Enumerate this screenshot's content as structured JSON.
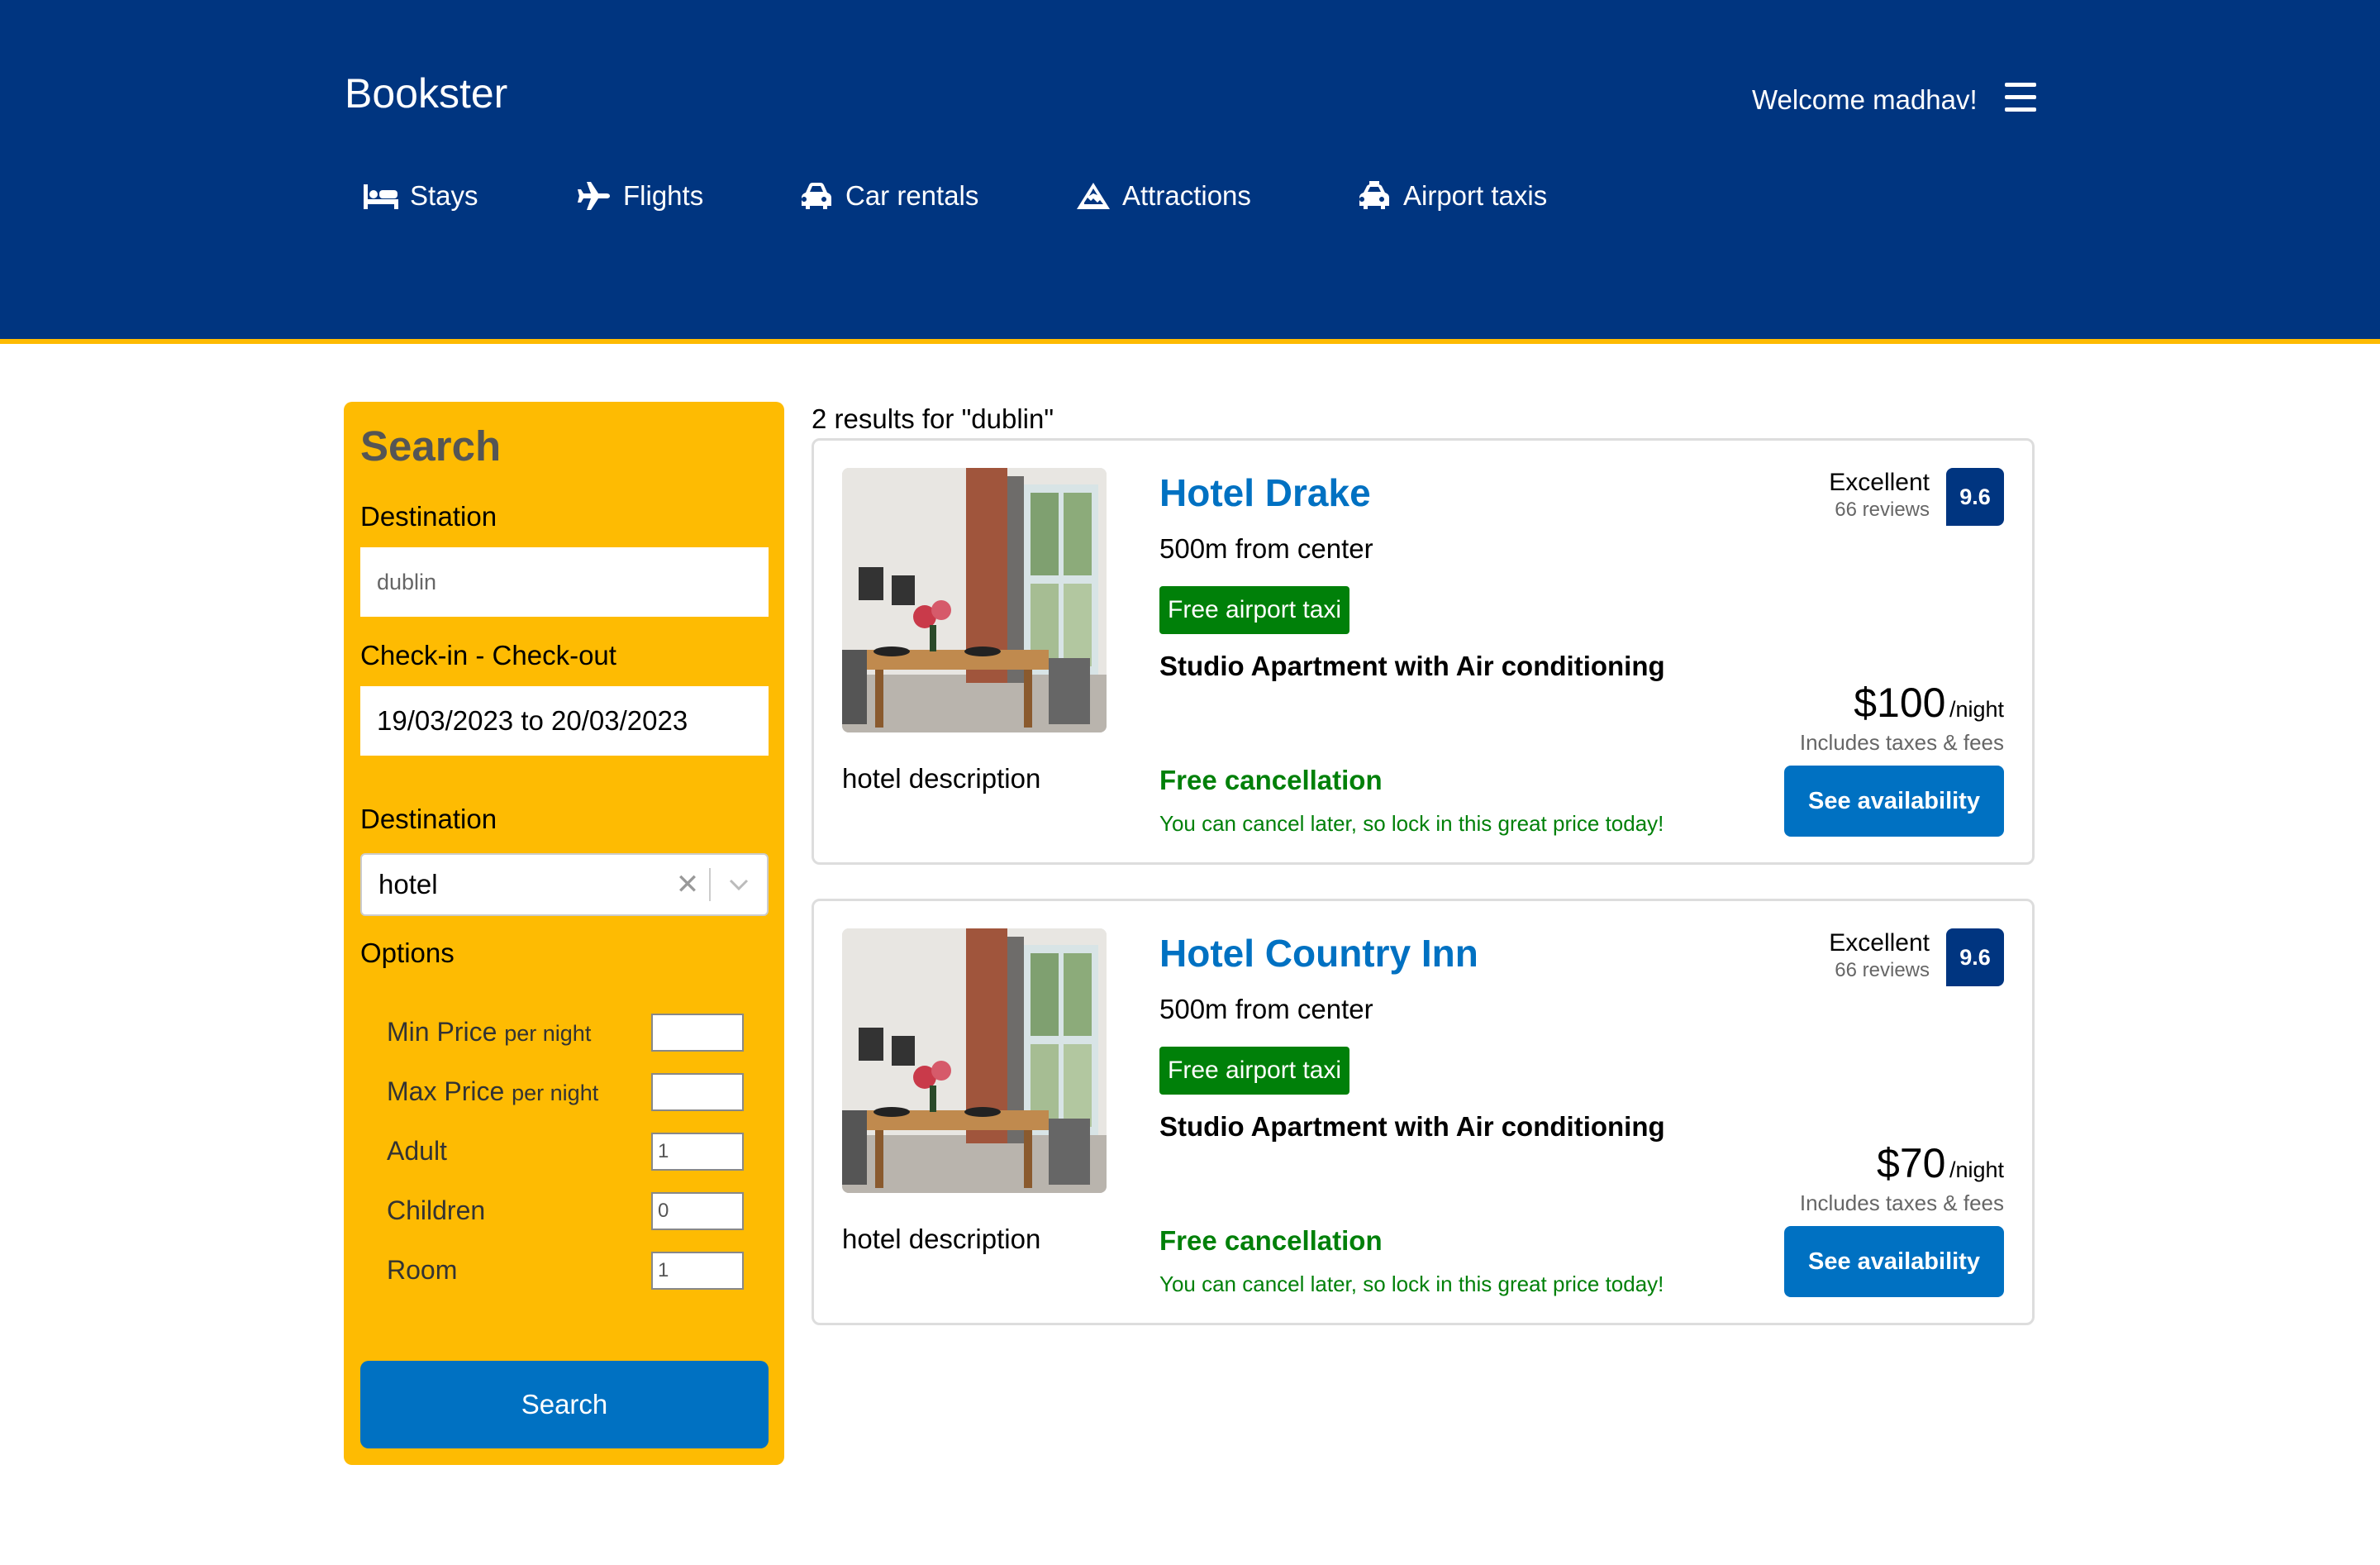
{
  "header": {
    "logo": "Bookster",
    "welcome": "Welcome madhav!",
    "nav": [
      {
        "label": "Stays",
        "icon": "bed-icon"
      },
      {
        "label": "Flights",
        "icon": "plane-icon"
      },
      {
        "label": "Car rentals",
        "icon": "car-icon"
      },
      {
        "label": "Attractions",
        "icon": "mountain-icon"
      },
      {
        "label": "Airport taxis",
        "icon": "taxi-icon"
      }
    ]
  },
  "search": {
    "title": "Search",
    "destination_label": "Destination",
    "destination_placeholder": "dublin",
    "dates_label": "Check-in - Check-out",
    "dates_value": "19/03/2023 to 20/03/2023",
    "type_label": "Destination",
    "type_value": "hotel",
    "options_label": "Options",
    "options": [
      {
        "label": "Min Price",
        "suffix": "per night",
        "value": ""
      },
      {
        "label": "Max Price",
        "suffix": "per night",
        "value": ""
      },
      {
        "label": "Adult",
        "suffix": "",
        "value": "1"
      },
      {
        "label": "Children",
        "suffix": "",
        "value": "0"
      },
      {
        "label": "Room",
        "suffix": "",
        "value": "1"
      }
    ],
    "button": "Search"
  },
  "results": {
    "count_text": "2 results for \"dublin\"",
    "items": [
      {
        "name": "Hotel Drake",
        "distance": "500m from center",
        "taxi": "Free airport taxi",
        "room": "Studio Apartment with Air conditioning",
        "description": "hotel description",
        "cancel_title": "Free cancellation",
        "cancel_note": "You can cancel later, so lock in this great price today!",
        "rating_label": "Excellent",
        "reviews": "66 reviews",
        "score": "9.6",
        "price": "$100",
        "per": "/night",
        "taxes": "Includes taxes & fees",
        "button": "See availability"
      },
      {
        "name": "Hotel Country Inn",
        "distance": "500m from center",
        "taxi": "Free airport taxi",
        "room": "Studio Apartment with Air conditioning",
        "description": "hotel description",
        "cancel_title": "Free cancellation",
        "cancel_note": "You can cancel later, so lock in this great price today!",
        "rating_label": "Excellent",
        "reviews": "66 reviews",
        "score": "9.6",
        "price": "$70",
        "per": "/night",
        "taxes": "Includes taxes & fees",
        "button": "See availability"
      }
    ]
  },
  "colors": {
    "header_bg": "#003580",
    "accent_yellow": "#febb02",
    "button_blue": "#0071c2",
    "green": "#008009"
  }
}
